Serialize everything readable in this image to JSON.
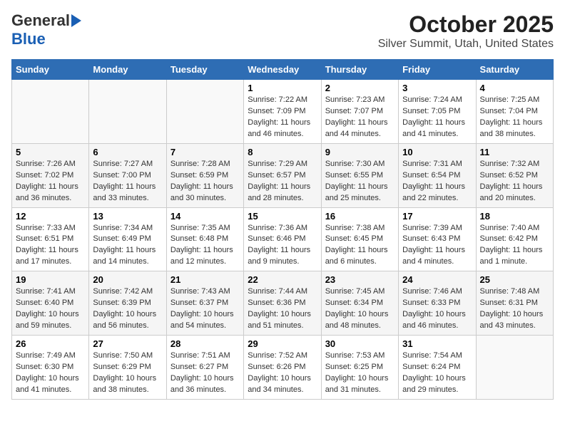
{
  "header": {
    "logo_general": "General",
    "logo_blue": "Blue",
    "title": "October 2025",
    "subtitle": "Silver Summit, Utah, United States"
  },
  "weekdays": [
    "Sunday",
    "Monday",
    "Tuesday",
    "Wednesday",
    "Thursday",
    "Friday",
    "Saturday"
  ],
  "weeks": [
    [
      {
        "day": "",
        "sunrise": "",
        "sunset": "",
        "daylight": ""
      },
      {
        "day": "",
        "sunrise": "",
        "sunset": "",
        "daylight": ""
      },
      {
        "day": "",
        "sunrise": "",
        "sunset": "",
        "daylight": ""
      },
      {
        "day": "1",
        "sunrise": "Sunrise: 7:22 AM",
        "sunset": "Sunset: 7:09 PM",
        "daylight": "Daylight: 11 hours and 46 minutes."
      },
      {
        "day": "2",
        "sunrise": "Sunrise: 7:23 AM",
        "sunset": "Sunset: 7:07 PM",
        "daylight": "Daylight: 11 hours and 44 minutes."
      },
      {
        "day": "3",
        "sunrise": "Sunrise: 7:24 AM",
        "sunset": "Sunset: 7:05 PM",
        "daylight": "Daylight: 11 hours and 41 minutes."
      },
      {
        "day": "4",
        "sunrise": "Sunrise: 7:25 AM",
        "sunset": "Sunset: 7:04 PM",
        "daylight": "Daylight: 11 hours and 38 minutes."
      }
    ],
    [
      {
        "day": "5",
        "sunrise": "Sunrise: 7:26 AM",
        "sunset": "Sunset: 7:02 PM",
        "daylight": "Daylight: 11 hours and 36 minutes."
      },
      {
        "day": "6",
        "sunrise": "Sunrise: 7:27 AM",
        "sunset": "Sunset: 7:00 PM",
        "daylight": "Daylight: 11 hours and 33 minutes."
      },
      {
        "day": "7",
        "sunrise": "Sunrise: 7:28 AM",
        "sunset": "Sunset: 6:59 PM",
        "daylight": "Daylight: 11 hours and 30 minutes."
      },
      {
        "day": "8",
        "sunrise": "Sunrise: 7:29 AM",
        "sunset": "Sunset: 6:57 PM",
        "daylight": "Daylight: 11 hours and 28 minutes."
      },
      {
        "day": "9",
        "sunrise": "Sunrise: 7:30 AM",
        "sunset": "Sunset: 6:55 PM",
        "daylight": "Daylight: 11 hours and 25 minutes."
      },
      {
        "day": "10",
        "sunrise": "Sunrise: 7:31 AM",
        "sunset": "Sunset: 6:54 PM",
        "daylight": "Daylight: 11 hours and 22 minutes."
      },
      {
        "day": "11",
        "sunrise": "Sunrise: 7:32 AM",
        "sunset": "Sunset: 6:52 PM",
        "daylight": "Daylight: 11 hours and 20 minutes."
      }
    ],
    [
      {
        "day": "12",
        "sunrise": "Sunrise: 7:33 AM",
        "sunset": "Sunset: 6:51 PM",
        "daylight": "Daylight: 11 hours and 17 minutes."
      },
      {
        "day": "13",
        "sunrise": "Sunrise: 7:34 AM",
        "sunset": "Sunset: 6:49 PM",
        "daylight": "Daylight: 11 hours and 14 minutes."
      },
      {
        "day": "14",
        "sunrise": "Sunrise: 7:35 AM",
        "sunset": "Sunset: 6:48 PM",
        "daylight": "Daylight: 11 hours and 12 minutes."
      },
      {
        "day": "15",
        "sunrise": "Sunrise: 7:36 AM",
        "sunset": "Sunset: 6:46 PM",
        "daylight": "Daylight: 11 hours and 9 minutes."
      },
      {
        "day": "16",
        "sunrise": "Sunrise: 7:38 AM",
        "sunset": "Sunset: 6:45 PM",
        "daylight": "Daylight: 11 hours and 6 minutes."
      },
      {
        "day": "17",
        "sunrise": "Sunrise: 7:39 AM",
        "sunset": "Sunset: 6:43 PM",
        "daylight": "Daylight: 11 hours and 4 minutes."
      },
      {
        "day": "18",
        "sunrise": "Sunrise: 7:40 AM",
        "sunset": "Sunset: 6:42 PM",
        "daylight": "Daylight: 11 hours and 1 minute."
      }
    ],
    [
      {
        "day": "19",
        "sunrise": "Sunrise: 7:41 AM",
        "sunset": "Sunset: 6:40 PM",
        "daylight": "Daylight: 10 hours and 59 minutes."
      },
      {
        "day": "20",
        "sunrise": "Sunrise: 7:42 AM",
        "sunset": "Sunset: 6:39 PM",
        "daylight": "Daylight: 10 hours and 56 minutes."
      },
      {
        "day": "21",
        "sunrise": "Sunrise: 7:43 AM",
        "sunset": "Sunset: 6:37 PM",
        "daylight": "Daylight: 10 hours and 54 minutes."
      },
      {
        "day": "22",
        "sunrise": "Sunrise: 7:44 AM",
        "sunset": "Sunset: 6:36 PM",
        "daylight": "Daylight: 10 hours and 51 minutes."
      },
      {
        "day": "23",
        "sunrise": "Sunrise: 7:45 AM",
        "sunset": "Sunset: 6:34 PM",
        "daylight": "Daylight: 10 hours and 48 minutes."
      },
      {
        "day": "24",
        "sunrise": "Sunrise: 7:46 AM",
        "sunset": "Sunset: 6:33 PM",
        "daylight": "Daylight: 10 hours and 46 minutes."
      },
      {
        "day": "25",
        "sunrise": "Sunrise: 7:48 AM",
        "sunset": "Sunset: 6:31 PM",
        "daylight": "Daylight: 10 hours and 43 minutes."
      }
    ],
    [
      {
        "day": "26",
        "sunrise": "Sunrise: 7:49 AM",
        "sunset": "Sunset: 6:30 PM",
        "daylight": "Daylight: 10 hours and 41 minutes."
      },
      {
        "day": "27",
        "sunrise": "Sunrise: 7:50 AM",
        "sunset": "Sunset: 6:29 PM",
        "daylight": "Daylight: 10 hours and 38 minutes."
      },
      {
        "day": "28",
        "sunrise": "Sunrise: 7:51 AM",
        "sunset": "Sunset: 6:27 PM",
        "daylight": "Daylight: 10 hours and 36 minutes."
      },
      {
        "day": "29",
        "sunrise": "Sunrise: 7:52 AM",
        "sunset": "Sunset: 6:26 PM",
        "daylight": "Daylight: 10 hours and 34 minutes."
      },
      {
        "day": "30",
        "sunrise": "Sunrise: 7:53 AM",
        "sunset": "Sunset: 6:25 PM",
        "daylight": "Daylight: 10 hours and 31 minutes."
      },
      {
        "day": "31",
        "sunrise": "Sunrise: 7:54 AM",
        "sunset": "Sunset: 6:24 PM",
        "daylight": "Daylight: 10 hours and 29 minutes."
      },
      {
        "day": "",
        "sunrise": "",
        "sunset": "",
        "daylight": ""
      }
    ]
  ]
}
